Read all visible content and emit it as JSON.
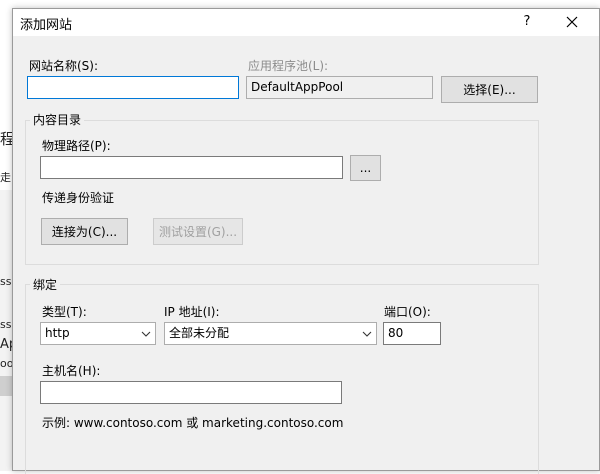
{
  "background": {
    "frag_a": "程",
    "frag_b": "走",
    "frag_c": "ss",
    "frag_d": "ss",
    "frag_e": "Ap",
    "frag_f": "oo",
    "frag_g": "手"
  },
  "dialog": {
    "title": "添加网站",
    "help_label": "?"
  },
  "site": {
    "name_label": "网站名称(S):",
    "name_value": "",
    "app_pool_label": "应用程序池(L):",
    "app_pool_value": "DefaultAppPool",
    "select_button": "选择(E)..."
  },
  "content": {
    "group_title": "内容目录",
    "physical_path_label": "物理路径(P):",
    "physical_path_value": "",
    "browse_button": "...",
    "pass_through_label": "传递身份验证",
    "connect_as_button": "连接为(C)...",
    "test_settings_button": "测试设置(G)..."
  },
  "binding": {
    "group_title": "绑定",
    "type_label": "类型(T):",
    "type_value": "http",
    "ip_label": "IP 地址(I):",
    "ip_value": "全部未分配",
    "port_label": "端口(O):",
    "port_value": "80",
    "host_label": "主机名(H):",
    "host_value": "",
    "example_text": "示例: www.contoso.com 或 marketing.contoso.com"
  },
  "colors": {
    "focus_border": "#0078d7",
    "dialog_bg": "#f0f0f0"
  },
  "icons": {
    "close": "close-icon",
    "dropdown": "chevron-down-icon"
  }
}
